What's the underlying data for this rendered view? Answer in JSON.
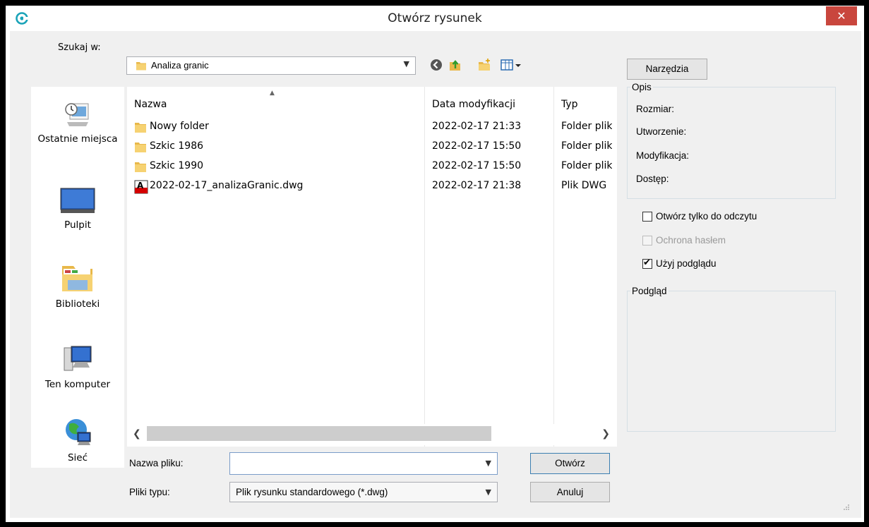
{
  "window": {
    "title": "Otwórz rysunek"
  },
  "lookin": {
    "label": "Szukaj w:",
    "value": "Analiza granic"
  },
  "places": [
    {
      "label": "Ostatnie miejsca"
    },
    {
      "label": "Pulpit"
    },
    {
      "label": "Biblioteki"
    },
    {
      "label": "Ten komputer"
    },
    {
      "label": "Sieć"
    }
  ],
  "columns": {
    "name": "Nazwa",
    "date": "Data modyfikacji",
    "type": "Typ"
  },
  "files": [
    {
      "name": "Nowy folder",
      "date": "2022-02-17 21:33",
      "type": "Folder plików",
      "icon": "folder-icon"
    },
    {
      "name": "Szkic 1986",
      "date": "2022-02-17 15:50",
      "type": "Folder plików",
      "icon": "folder-icon"
    },
    {
      "name": "Szkic 1990",
      "date": "2022-02-17 15:50",
      "type": "Folder plików",
      "icon": "folder-icon"
    },
    {
      "name": "2022-02-17_analizaGranic.dwg",
      "date": "2022-02-17 21:38",
      "type": "Plik DWG",
      "icon": "dwg-file-icon"
    }
  ],
  "filename": {
    "label": "Nazwa pliku:",
    "value": ""
  },
  "filetype": {
    "label": "Pliki typu:",
    "value": "Plik rysunku standardowego (*.dwg)"
  },
  "buttons": {
    "open": "Otwórz",
    "cancel": "Anuluj",
    "tools": "Narzędzia"
  },
  "description": {
    "title": "Opis",
    "size": "Rozmiar:",
    "created": "Utworzenie:",
    "modified": "Modyfikacja:",
    "access": "Dostęp:"
  },
  "options": {
    "readonly": {
      "label": "Otwórz tylko do odczytu",
      "checked": false
    },
    "password": {
      "label": "Ochrona hasłem",
      "checked": false,
      "disabled": true
    },
    "preview": {
      "label": "Użyj podglądu",
      "checked": true
    }
  },
  "preview": {
    "title": "Podgląd"
  },
  "colors": {
    "close": "#c9463d",
    "accent": "#3c7fb1",
    "folder": "#e8b84a"
  }
}
